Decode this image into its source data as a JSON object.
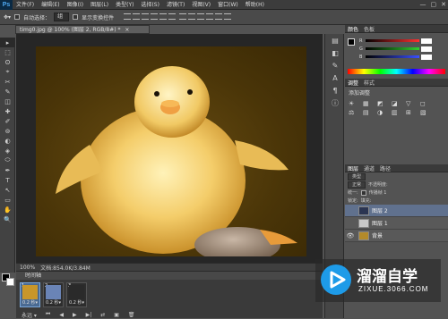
{
  "app": {
    "logo": "Ps"
  },
  "menu": [
    "文件(F)",
    "编辑(E)",
    "图像(I)",
    "图层(L)",
    "类型(Y)",
    "选择(S)",
    "滤镜(T)",
    "视图(V)",
    "窗口(W)",
    "帮助(H)"
  ],
  "window_controls": [
    "—",
    "▢",
    "✕"
  ],
  "options": {
    "auto_select_label": "自动选择：",
    "auto_select_value": "组",
    "transform_label": "显示变换控件"
  },
  "document": {
    "tab_label": "timg0.jpg @ 100% (图层 2, RGB/8#) *",
    "close": "×"
  },
  "status": {
    "zoom": "100%",
    "doc_size": "文档:854.0K/3.84M"
  },
  "timeline": {
    "title": "时间轴",
    "frames": [
      {
        "num": "1",
        "delay": "0.2 秒▾",
        "thumb_color": "#c8962a"
      },
      {
        "num": "2",
        "delay": "0.2 秒▾",
        "thumb_color": "#6a84b6"
      },
      {
        "num": "3",
        "delay": "0.2 秒▾",
        "thumb_color": "#2a2a2a"
      }
    ],
    "controls": [
      "永远 ▾",
      "⏮",
      "◀",
      "▶",
      "▶|",
      "⇄",
      "▣",
      "🗑"
    ]
  },
  "tools": [
    "▸",
    "⬚",
    "ʘ",
    "⌖",
    "✂",
    "✎",
    "◫",
    "✚",
    "✐",
    "⊚",
    "◐",
    "◈",
    "⬭",
    "✒",
    "T",
    "↖",
    "▭",
    "✋",
    "🔍"
  ],
  "right_panel": {
    "color_tabs": [
      "颜色",
      "色板"
    ],
    "color_sliders": [
      {
        "label": "R",
        "track": "#ff4444"
      },
      {
        "label": "G",
        "track": "#33cc33"
      },
      {
        "label": "B",
        "track": "#4444ff"
      }
    ],
    "adj_tabs": [
      "调整",
      "样式"
    ],
    "adj_title": "添加调整",
    "adj_icons": [
      "☀",
      "▦",
      "◩",
      "◪",
      "▽",
      "◻",
      "⚖",
      "▤",
      "◑",
      "▥",
      "⊞",
      "▧"
    ],
    "layer_tabs": [
      "图层",
      "通道",
      "路径"
    ],
    "kind_label": "类型",
    "blend_mode": "正常",
    "opacity_label": "不透明度:",
    "lock_label": "锁定:",
    "fill_label": "填充:",
    "unify_label": "统一:",
    "propagate_label": "传播帧 1",
    "layers": [
      {
        "name": "图层 2",
        "selected": true,
        "thumb": "#2b3552"
      },
      {
        "name": "图层 1",
        "selected": false,
        "thumb": "#c9c9c9"
      },
      {
        "name": "背景",
        "selected": false,
        "thumb": "#b38a2a"
      }
    ]
  },
  "watermark": {
    "cn": "溜溜自学",
    "url": "ZIXUE.3066.COM"
  }
}
